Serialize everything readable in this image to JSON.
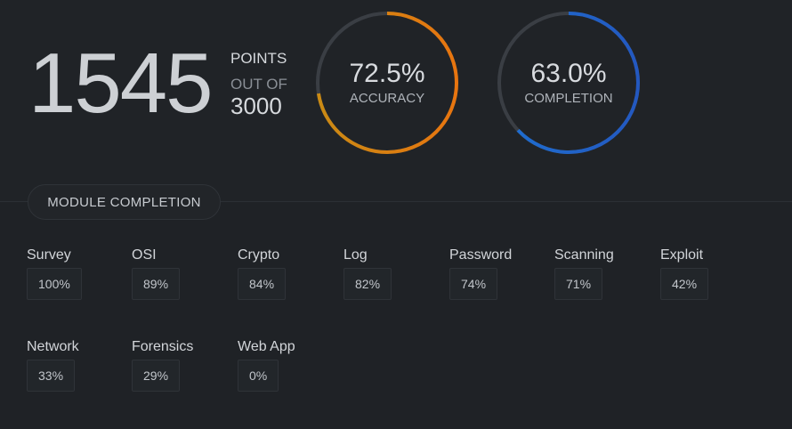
{
  "score": {
    "points": "1545",
    "points_label": "POINTS",
    "out_of_label": "OUT OF",
    "total": "3000"
  },
  "gauges": [
    {
      "value_text": "72.5%",
      "label": "ACCURACY",
      "fraction": 0.725,
      "track_color": "#3a3e44",
      "colors": [
        "#c98a14",
        "#e8750f"
      ]
    },
    {
      "value_text": "63.0%",
      "label": "COMPLETION",
      "fraction": 0.63,
      "track_color": "#3a3e44",
      "colors": [
        "#1e6fd0",
        "#2358c0"
      ]
    }
  ],
  "module_section": {
    "title": "MODULE COMPLETION"
  },
  "modules": [
    {
      "name": "Survey",
      "percent": "100%"
    },
    {
      "name": "OSI",
      "percent": "89%"
    },
    {
      "name": "Crypto",
      "percent": "84%"
    },
    {
      "name": "Log",
      "percent": "82%"
    },
    {
      "name": "Password",
      "percent": "74%"
    },
    {
      "name": "Scanning",
      "percent": "71%"
    },
    {
      "name": "Exploit",
      "percent": "42%"
    },
    {
      "name": "Network",
      "percent": "33%"
    },
    {
      "name": "Forensics",
      "percent": "29%"
    },
    {
      "name": "Web App",
      "percent": "0%"
    }
  ]
}
